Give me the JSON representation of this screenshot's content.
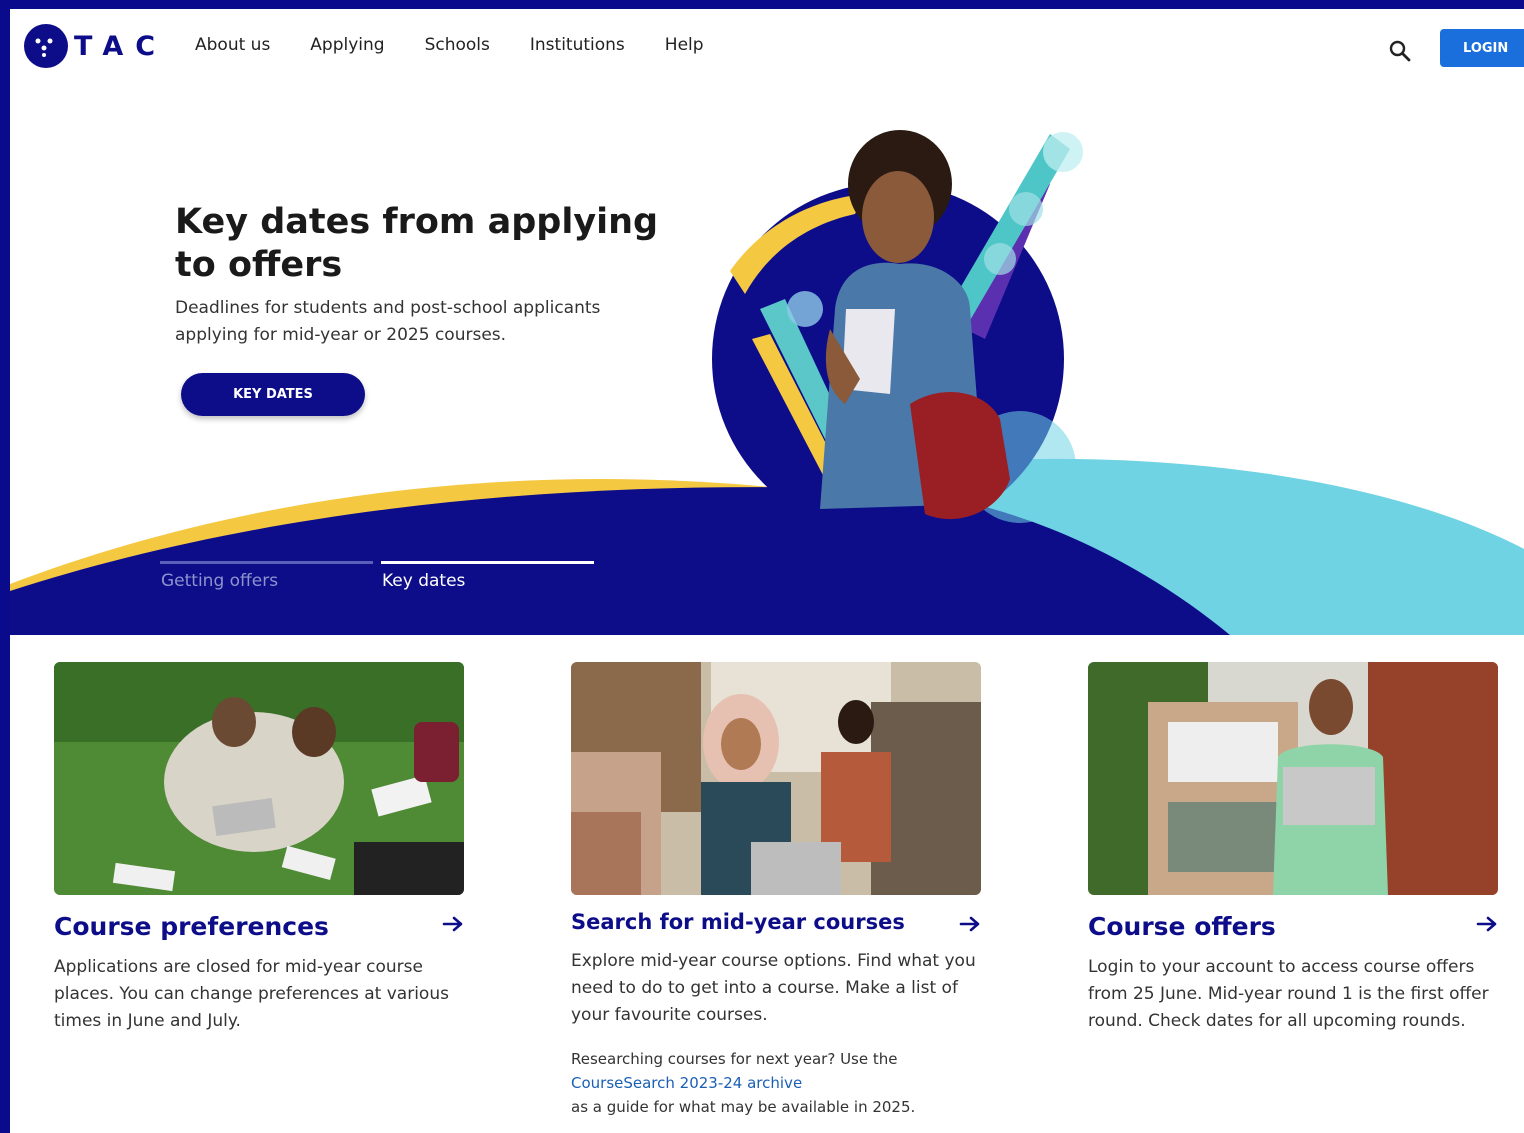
{
  "header": {
    "logo_text": "TAC",
    "nav": [
      {
        "label": "About us"
      },
      {
        "label": "Applying"
      },
      {
        "label": "Schools"
      },
      {
        "label": "Institutions"
      },
      {
        "label": "Help"
      }
    ],
    "login_label": "LOGIN"
  },
  "hero": {
    "title": "Key dates from applying to offers",
    "subtitle": "Deadlines for students and post-school applicants applying for mid-year or 2025 courses.",
    "button_label": "KEY DATES",
    "tabs": [
      {
        "label": "Getting offers",
        "active": false
      },
      {
        "label": "Key dates",
        "active": true
      }
    ]
  },
  "cards": [
    {
      "title": "Course preferences",
      "body": "Applications are closed for mid-year course places. You can change preferences at various times in June and July."
    },
    {
      "title": "Search for mid-year courses",
      "body": "Explore mid-year course options. Find what you need to do to get into a course. Make a list of your favourite courses.",
      "note_prefix": "Researching courses for next year? Use the",
      "note_link": "CourseSearch 2023-24 archive",
      "note_suffix": "as a guide for what may be available in 2025."
    },
    {
      "title": "Course offers",
      "body": "Login to your account to access course offers from 25 June. Mid-year round 1 is the first offer round. Check dates for all upcoming rounds."
    }
  ],
  "colors": {
    "navy": "#0d0d8a",
    "yellow": "#f5c842",
    "teal": "#6fd3e3",
    "login_blue": "#1a6fdd",
    "link_blue": "#1a5fb4"
  }
}
